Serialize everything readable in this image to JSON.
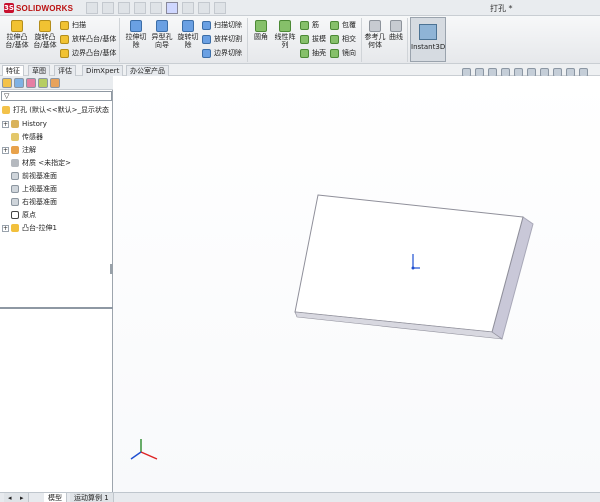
{
  "window": {
    "title": "打孔 *"
  },
  "logo": {
    "brand": "SOLIDWORKS"
  },
  "ribbon": {
    "groups": [
      {
        "buttons": [
          {
            "label": "拉伸凸台/基体"
          },
          {
            "label": "旋转凸台/基体"
          }
        ],
        "smalls": [
          {
            "label": "扫描"
          },
          {
            "label": "放样凸台/基体"
          },
          {
            "label": "边界凸台/基体"
          }
        ]
      },
      {
        "buttons": [
          {
            "label": "拉伸切除"
          },
          {
            "label": "异型孔向导"
          },
          {
            "label": "旋转切除"
          }
        ],
        "smalls": [
          {
            "label": "扫描切除"
          },
          {
            "label": "放样切割"
          },
          {
            "label": "边界切除"
          }
        ]
      },
      {
        "buttons": [
          {
            "label": "圆角"
          },
          {
            "label": "线性阵列"
          }
        ],
        "smalls": [
          {
            "label": "筋"
          },
          {
            "label": "拔模"
          },
          {
            "label": "抽壳"
          },
          {
            "label": "包覆"
          },
          {
            "label": "相交"
          },
          {
            "label": "镜向"
          }
        ]
      },
      {
        "buttons": [
          {
            "label": "参考几何体"
          },
          {
            "label": "曲线"
          }
        ]
      }
    ],
    "instant3d": {
      "label": "Instant3D"
    }
  },
  "command_tabs": [
    "特征",
    "草图",
    "评估",
    "DimXpert",
    "办公室产品"
  ],
  "feature_tree": {
    "filter_placeholder": "",
    "root": "打孔 (默认<<默认>_显示状态",
    "items": [
      {
        "label": "History",
        "expand": true
      },
      {
        "label": "传感器",
        "expand": false
      },
      {
        "label": "注解",
        "expand": true
      },
      {
        "label": "材质 <未指定>",
        "expand": false
      },
      {
        "label": "前视基准面",
        "expand": false
      },
      {
        "label": "上视基准面",
        "expand": false
      },
      {
        "label": "右视基准面",
        "expand": false
      },
      {
        "label": "原点",
        "expand": false
      },
      {
        "label": "凸台-拉伸1",
        "expand": true
      }
    ]
  },
  "bottom_tabs": [
    "模型",
    "运动算例 1"
  ]
}
